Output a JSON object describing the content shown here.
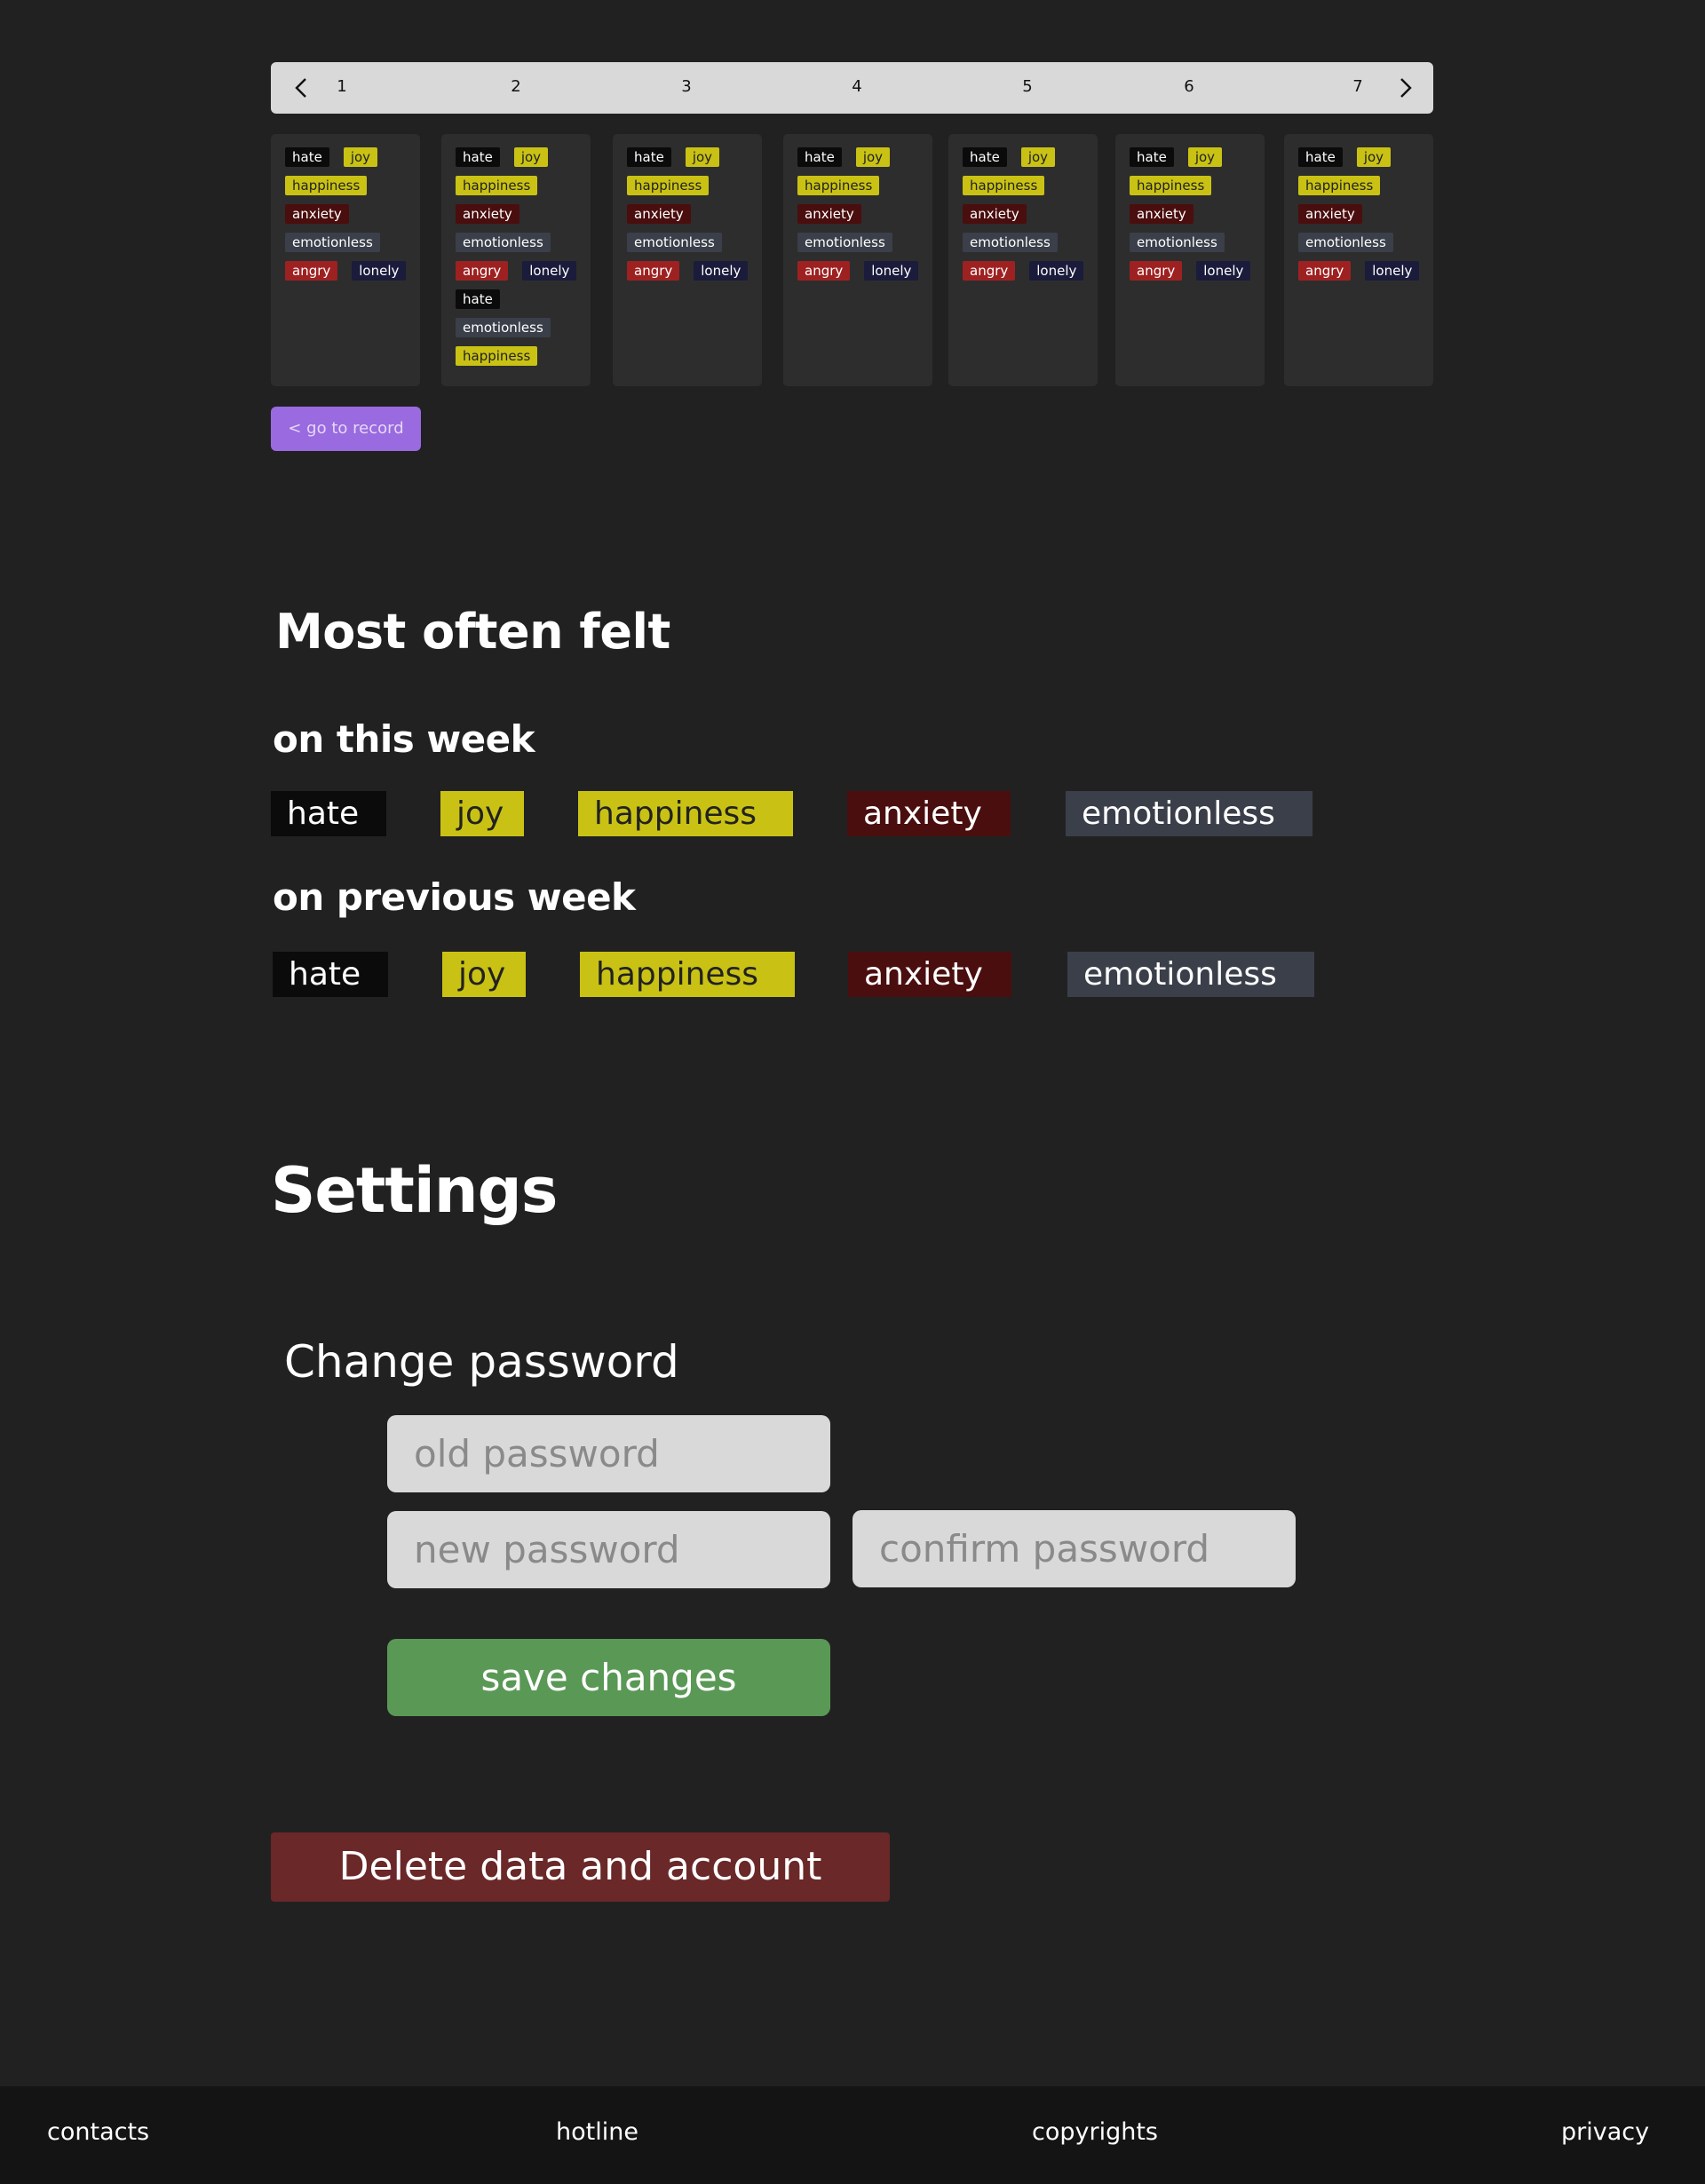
{
  "pager": {
    "days": [
      "1",
      "2",
      "3",
      "4",
      "5",
      "6",
      "7"
    ]
  },
  "days": [
    {
      "rows": [
        [
          "hate",
          "joy"
        ],
        [
          "happiness"
        ],
        [
          "anxiety"
        ],
        [
          "emotionless"
        ],
        [
          "angry",
          "lonely"
        ]
      ]
    },
    {
      "rows": [
        [
          "hate",
          "joy"
        ],
        [
          "happiness"
        ],
        [
          "anxiety"
        ],
        [
          "emotionless"
        ],
        [
          "angry",
          "lonely"
        ],
        [
          "hate"
        ],
        [
          "emotionless"
        ],
        [
          "happiness"
        ]
      ]
    },
    {
      "rows": [
        [
          "hate",
          "joy"
        ],
        [
          "happiness"
        ],
        [
          "anxiety"
        ],
        [
          "emotionless"
        ],
        [
          "angry",
          "lonely"
        ]
      ]
    },
    {
      "rows": [
        [
          "hate",
          "joy"
        ],
        [
          "happiness"
        ],
        [
          "anxiety"
        ],
        [
          "emotionless"
        ],
        [
          "angry",
          "lonely"
        ]
      ]
    },
    {
      "rows": [
        [
          "hate",
          "joy"
        ],
        [
          "happiness"
        ],
        [
          "anxiety"
        ],
        [
          "emotionless"
        ],
        [
          "angry",
          "lonely"
        ]
      ]
    },
    {
      "rows": [
        [
          "hate",
          "joy"
        ],
        [
          "happiness"
        ],
        [
          "anxiety"
        ],
        [
          "emotionless"
        ],
        [
          "angry",
          "lonely"
        ]
      ]
    },
    {
      "rows": [
        [
          "hate",
          "joy"
        ],
        [
          "happiness"
        ],
        [
          "anxiety"
        ],
        [
          "emotionless"
        ],
        [
          "angry",
          "lonely"
        ]
      ]
    }
  ],
  "go_to_record": "< go to record",
  "most_often": {
    "title": "Most often felt",
    "this_week": {
      "label": "on this week",
      "emotions": [
        "hate",
        "joy",
        "happiness",
        "anxiety",
        "emotionless"
      ]
    },
    "previous_week": {
      "label": "on previous week",
      "emotions": [
        "hate",
        "joy",
        "happiness",
        "anxiety",
        "emotionless"
      ]
    }
  },
  "settings": {
    "title": "Settings",
    "change_password": {
      "title": "Change password",
      "old_placeholder": "old password",
      "new_placeholder": "new password",
      "confirm_placeholder": "confirm password",
      "save_label": "save changes"
    },
    "delete_label": "Delete data and account"
  },
  "footer": {
    "contacts": "contacts",
    "hotline": "hotline",
    "copyrights": "copyrights",
    "privacy": "privacy"
  },
  "colors": {
    "background": "#212121",
    "pager": "#d9d9d9",
    "purple_button": "#9a6ae0",
    "save_button": "#5a9856",
    "delete_button": "#6a2828",
    "hate": "#0b0b0b",
    "joy": "#c9c214",
    "anxiety": "#4a0e0e",
    "emotionless": "#3a3f4a",
    "angry": "#9e2121",
    "lonely": "#1b1b3c"
  }
}
